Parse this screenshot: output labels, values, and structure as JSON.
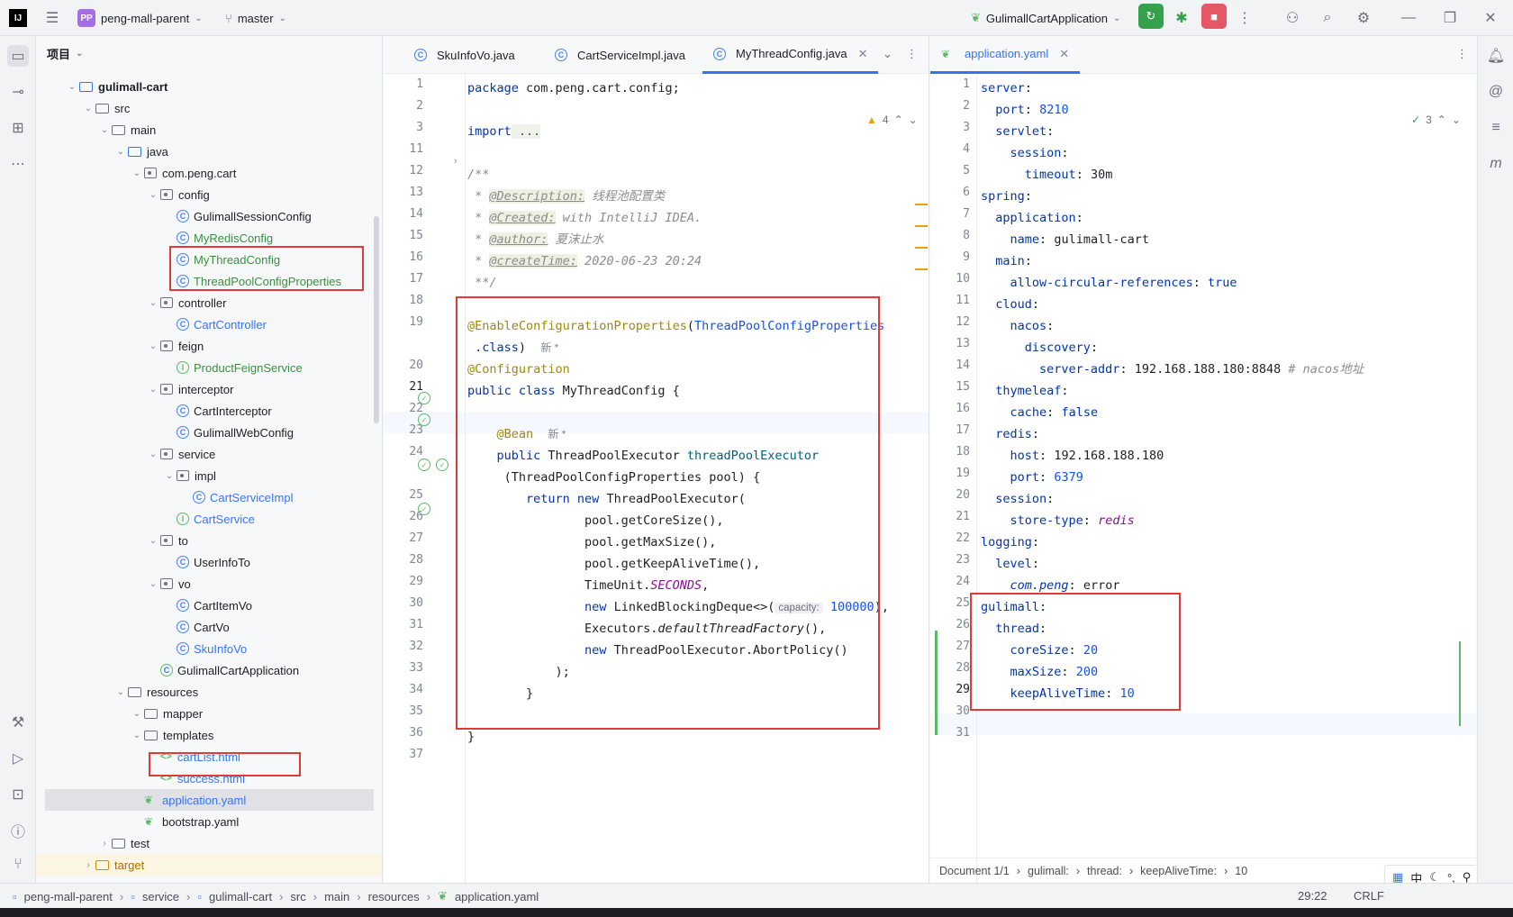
{
  "topbar": {
    "project_badge": "PP",
    "project_name": "peng-mall-parent",
    "branch": "master",
    "run_config": "GulimallCartApplication"
  },
  "project_panel": {
    "title": "项目",
    "tree": [
      {
        "label": "gulimall-cart",
        "kind": "module",
        "depth": 2,
        "bold": true
      },
      {
        "label": "src",
        "kind": "folder",
        "depth": 3
      },
      {
        "label": "main",
        "kind": "folder",
        "depth": 4
      },
      {
        "label": "java",
        "kind": "srcfolder",
        "depth": 5
      },
      {
        "label": "com.peng.cart",
        "kind": "package",
        "depth": 6
      },
      {
        "label": "config",
        "kind": "package",
        "depth": 7
      },
      {
        "label": "GulimallSessionConfig",
        "kind": "class",
        "depth": 8
      },
      {
        "label": "MyRedisConfig",
        "kind": "class",
        "depth": 8,
        "color": "green"
      },
      {
        "label": "MyThreadConfig",
        "kind": "class",
        "depth": 8,
        "color": "green"
      },
      {
        "label": "ThreadPoolConfigProperties",
        "kind": "class",
        "depth": 8,
        "color": "green"
      },
      {
        "label": "controller",
        "kind": "package",
        "depth": 7
      },
      {
        "label": "CartController",
        "kind": "class",
        "depth": 8,
        "color": "blue"
      },
      {
        "label": "feign",
        "kind": "package",
        "depth": 7
      },
      {
        "label": "ProductFeignService",
        "kind": "interface",
        "depth": 8,
        "color": "green"
      },
      {
        "label": "interceptor",
        "kind": "package",
        "depth": 7
      },
      {
        "label": "CartInterceptor",
        "kind": "class",
        "depth": 8
      },
      {
        "label": "GulimallWebConfig",
        "kind": "class",
        "depth": 8
      },
      {
        "label": "service",
        "kind": "package",
        "depth": 7
      },
      {
        "label": "impl",
        "kind": "package",
        "depth": 8
      },
      {
        "label": "CartServiceImpl",
        "kind": "class",
        "depth": 9,
        "color": "blue"
      },
      {
        "label": "CartService",
        "kind": "interface",
        "depth": 8,
        "color": "blue"
      },
      {
        "label": "to",
        "kind": "package",
        "depth": 7
      },
      {
        "label": "UserInfoTo",
        "kind": "class",
        "depth": 8
      },
      {
        "label": "vo",
        "kind": "package",
        "depth": 7
      },
      {
        "label": "CartItemVo",
        "kind": "class",
        "depth": 8
      },
      {
        "label": "CartVo",
        "kind": "class",
        "depth": 8
      },
      {
        "label": "SkuInfoVo",
        "kind": "class",
        "depth": 8,
        "color": "blue"
      },
      {
        "label": "GulimallCartApplication",
        "kind": "springclass",
        "depth": 7
      },
      {
        "label": "resources",
        "kind": "folder",
        "depth": 5
      },
      {
        "label": "mapper",
        "kind": "folder",
        "depth": 6
      },
      {
        "label": "templates",
        "kind": "folder",
        "depth": 6
      },
      {
        "label": "cartList.html",
        "kind": "html",
        "depth": 7,
        "color": "blue"
      },
      {
        "label": "success.html",
        "kind": "html",
        "depth": 7,
        "color": "blue"
      },
      {
        "label": "application.yaml",
        "kind": "yaml",
        "depth": 6,
        "color": "blue",
        "selected": true
      },
      {
        "label": "bootstrap.yaml",
        "kind": "yaml",
        "depth": 6
      },
      {
        "label": "test",
        "kind": "folder",
        "depth": 4
      },
      {
        "label": "target",
        "kind": "folder",
        "depth": 3,
        "color": "orange"
      }
    ]
  },
  "editor_left": {
    "tabs": [
      "SkuInfoVo.java",
      "CartServiceImpl.java",
      "MyThreadConfig.java"
    ],
    "active_tab": "MyThreadConfig.java",
    "warnings": "4",
    "line_numbers": [
      "1",
      "2",
      "3",
      "11",
      "12",
      "13",
      "14",
      "15",
      "16",
      "17",
      "18",
      "19",
      "",
      "20",
      "21",
      "22",
      "23",
      "24",
      "",
      "25",
      "26",
      "27",
      "28",
      "29",
      "30",
      "31",
      "32",
      "33",
      "34",
      "35",
      "36",
      "37"
    ],
    "code": {
      "l1_kw": "package",
      "l1": " com.peng.cart.config;",
      "l3_kw": "import",
      "l3": " ...",
      "l11": "/**",
      "l12_pre": " * ",
      "l12_tag": "@Description:",
      "l12": " 线程池配置类",
      "l13_tag": "@Created:",
      "l13": " with IntelliJ IDEA.",
      "l14_tag": "@author:",
      "l14": " 夏沫止水",
      "l15_tag": "@createTime:",
      "l15": " 2020-06-23 20:24",
      "l16": " **/",
      "l18_ann": "@EnableConfigurationProperties",
      "l18_p": "(",
      "l18_cls": "ThreadPoolConfigProperties",
      "l18b_kw": ".class",
      "l18b": ")",
      "new_mark": "新 *",
      "l19_ann": "@Configuration",
      "l20_kw": "public class",
      "l20": " MyThreadConfig {",
      "l22_ann": "@Bean",
      "l23_kw": "public",
      "l23_t": " ThreadPoolExecutor ",
      "l23_m": "threadPoolExecutor",
      "l23b": "(ThreadPoolConfigProperties pool) {",
      "l24_kw": "return new",
      "l24": " ThreadPoolExecutor(",
      "l25": "pool.getCoreSize(),",
      "l26": "pool.getMaxSize(),",
      "l27": "pool.getKeepAliveTime(),",
      "l28_a": "TimeUnit.",
      "l28_f": "SECONDS",
      "l28_b": ",",
      "l29_kw": "new",
      "l29": " LinkedBlockingDeque<>(",
      "l29_hint": "capacity:",
      "l29_num": "100000",
      "l29_end": "),",
      "l30_a": "Executors.",
      "l30_i": "defaultThreadFactory",
      "l30_b": "(),",
      "l31_kw": "new",
      "l31": " ThreadPoolExecutor.AbortPolicy()",
      "l32": ");",
      "l33": "}",
      "l35": "}"
    }
  },
  "editor_right": {
    "tab": "application.yaml",
    "checks": "3",
    "line_numbers": [
      "1",
      "2",
      "3",
      "4",
      "5",
      "6",
      "7",
      "8",
      "9",
      "10",
      "11",
      "12",
      "13",
      "14",
      "15",
      "16",
      "17",
      "18",
      "19",
      "20",
      "21",
      "22",
      "23",
      "24",
      "25",
      "26",
      "27",
      "28",
      "29",
      "30",
      "31"
    ],
    "yaml": [
      {
        "indent": 0,
        "key": "server",
        "val": ""
      },
      {
        "indent": 1,
        "key": "port",
        "val": "8210",
        "vtype": "num"
      },
      {
        "indent": 1,
        "key": "servlet",
        "val": ""
      },
      {
        "indent": 2,
        "key": "session",
        "val": ""
      },
      {
        "indent": 3,
        "key": "timeout",
        "val": "30m",
        "vtype": "str"
      },
      {
        "indent": 0,
        "key": "spring",
        "val": ""
      },
      {
        "indent": 1,
        "key": "application",
        "val": ""
      },
      {
        "indent": 2,
        "key": "name",
        "val": "gulimall-cart",
        "vtype": "str"
      },
      {
        "indent": 1,
        "key": "main",
        "val": ""
      },
      {
        "indent": 2,
        "key": "allow-circular-references",
        "val": "true",
        "vtype": "kw"
      },
      {
        "indent": 1,
        "key": "cloud",
        "val": ""
      },
      {
        "indent": 2,
        "key": "nacos",
        "val": ""
      },
      {
        "indent": 3,
        "key": "discovery",
        "val": ""
      },
      {
        "indent": 4,
        "key": "server-addr",
        "val": "192.168.188.180:8848",
        "vtype": "str",
        "comment": "# nacos地址"
      },
      {
        "indent": 1,
        "key": "thymeleaf",
        "val": ""
      },
      {
        "indent": 2,
        "key": "cache",
        "val": "false",
        "vtype": "kw"
      },
      {
        "indent": 1,
        "key": "redis",
        "val": ""
      },
      {
        "indent": 2,
        "key": "host",
        "val": "192.168.188.180",
        "vtype": "str"
      },
      {
        "indent": 2,
        "key": "port",
        "val": "6379",
        "vtype": "num"
      },
      {
        "indent": 1,
        "key": "session",
        "val": ""
      },
      {
        "indent": 2,
        "key": "store-type",
        "val": "redis",
        "vtype": "field"
      },
      {
        "indent": 0,
        "key": "logging",
        "val": ""
      },
      {
        "indent": 1,
        "key": "level",
        "val": ""
      },
      {
        "indent": 2,
        "key": "com.peng",
        "val": "error",
        "vtype": "str",
        "italkey": true
      },
      {
        "indent": 0,
        "key": "gulimall",
        "val": ""
      },
      {
        "indent": 1,
        "key": "thread",
        "val": ""
      },
      {
        "indent": 2,
        "key": "coreSize",
        "val": "20",
        "vtype": "num"
      },
      {
        "indent": 2,
        "key": "maxSize",
        "val": "200",
        "vtype": "num"
      },
      {
        "indent": 2,
        "key": "keepAliveTime",
        "val": "10",
        "vtype": "num"
      },
      {
        "indent": 0,
        "key": "",
        "val": ""
      },
      {
        "indent": 0,
        "key": "",
        "val": ""
      }
    ],
    "breadcrumb": [
      "Document 1/1",
      "gulimall:",
      "thread:",
      "keepAliveTime:",
      "10"
    ]
  },
  "statusbar": {
    "path": [
      "peng-mall-parent",
      "service",
      "gulimall-cart",
      "src",
      "main",
      "resources",
      "application.yaml"
    ],
    "position": "29:22",
    "line_sep": "CRLF",
    "ime": "中"
  }
}
